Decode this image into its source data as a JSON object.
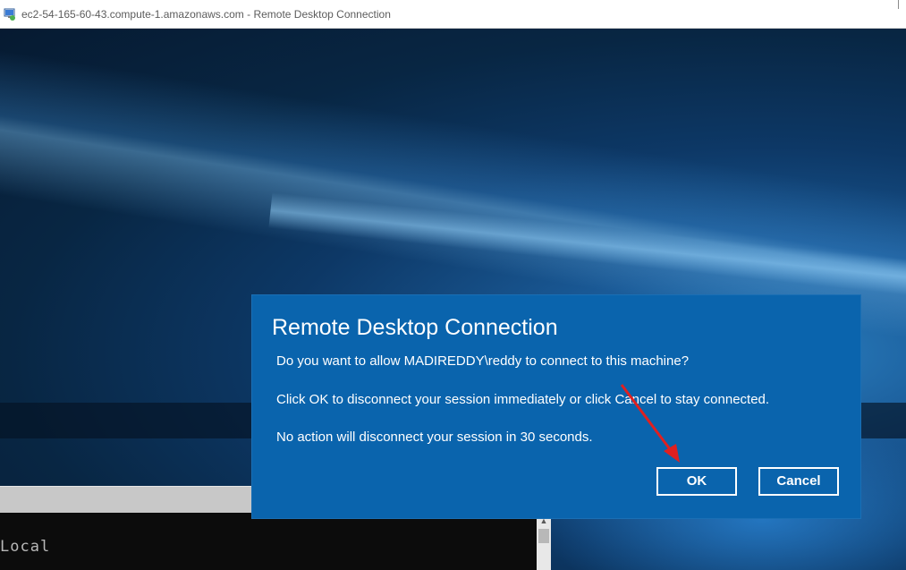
{
  "window": {
    "title": "ec2-54-165-60-43.compute-1.amazonaws.com - Remote Desktop Connection"
  },
  "background": {
    "console_text": "Local"
  },
  "dialog": {
    "title": "Remote Desktop Connection",
    "line1": "Do you want to allow MADIREDDY\\reddy to connect to this machine?",
    "line2": "Click OK to disconnect your session immediately or click Cancel to stay connected.",
    "line3": "No action will disconnect your session in 30 seconds.",
    "ok_label": "OK",
    "cancel_label": "Cancel"
  },
  "colors": {
    "dialog_bg": "#0a64ad",
    "annotation_arrow": "#e02020"
  },
  "icons": {
    "title_icon": "remote-desktop-icon",
    "scroll_up": "chevron-up-icon"
  }
}
